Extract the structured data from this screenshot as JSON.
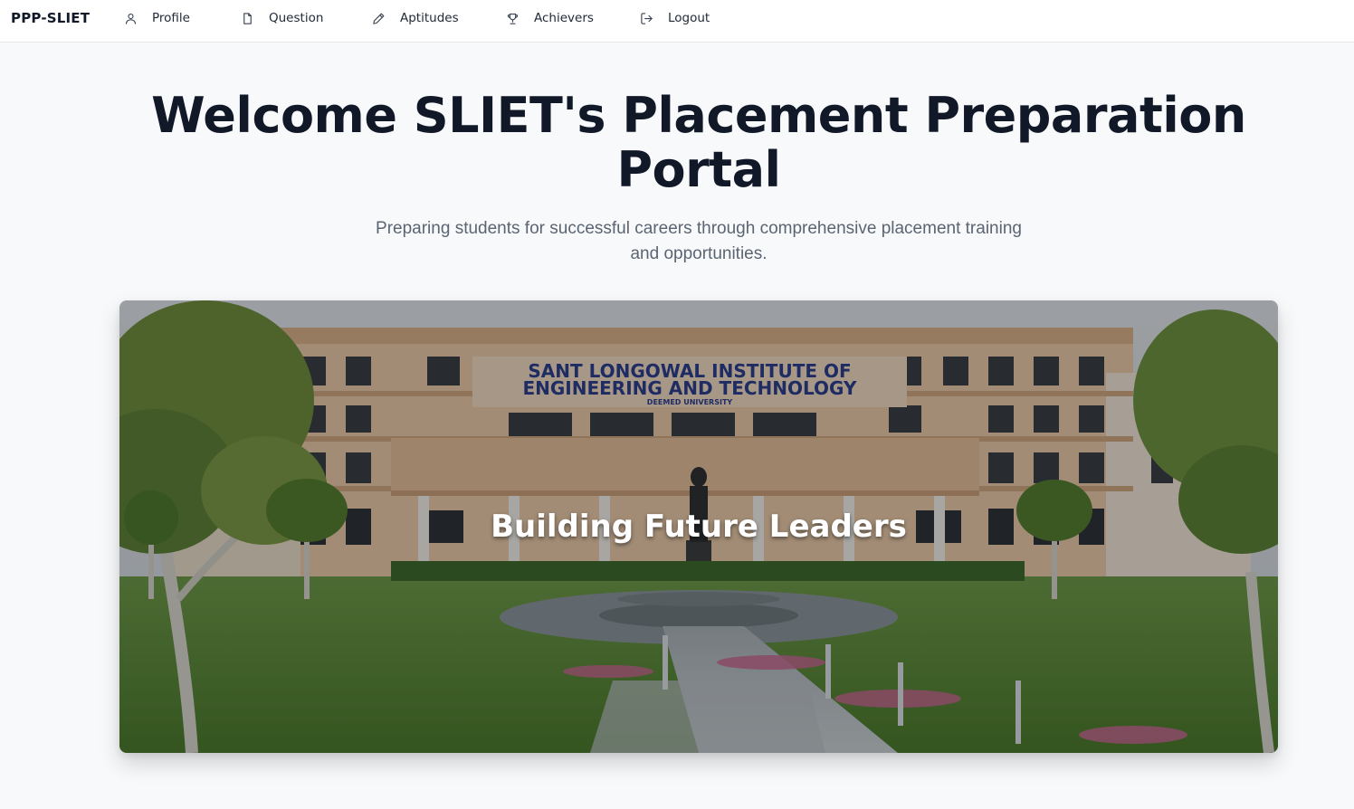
{
  "nav": {
    "brand": "PPP-SLIET",
    "items": [
      {
        "label": "Profile",
        "icon": "user-icon"
      },
      {
        "label": "Question",
        "icon": "file-icon"
      },
      {
        "label": "Aptitudes",
        "icon": "pencil-icon"
      },
      {
        "label": "Achievers",
        "icon": "trophy-icon"
      },
      {
        "label": "Logout",
        "icon": "logout-icon"
      }
    ]
  },
  "hero": {
    "title_line1": "Welcome SLIET's Placement Preparation",
    "title_line2": "Portal",
    "subtitle_line1": "Preparing students for successful careers through comprehensive placement training",
    "subtitle_line2": "and opportunities."
  },
  "banner": {
    "sign_line1": "SANT LONGOWAL INSTITUTE OF",
    "sign_line2": "ENGINEERING   AND   TECHNOLOGY",
    "sign_line3": "DEEMED UNIVERSITY",
    "caption": "Building Future Leaders"
  },
  "colors": {
    "page_bg": "#f8f9fb",
    "title": "#111827",
    "subtitle": "#5b6472",
    "sign_text": "#2b3f8f"
  }
}
